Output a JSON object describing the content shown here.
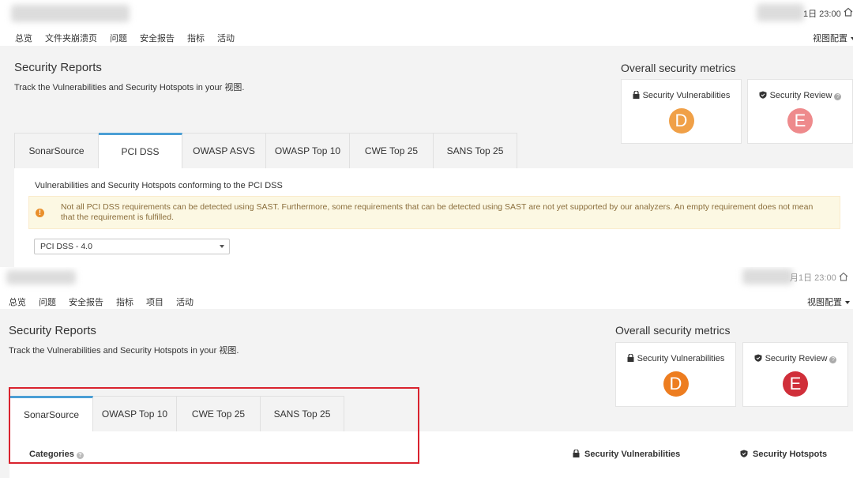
{
  "colors": {
    "grade_d_1": "#f0a047",
    "grade_e_1": "#ee8a8c",
    "grade_d_2": "#ed7d20",
    "grade_e_2": "#d02f3a",
    "active_tab_border": "#4b9fd5",
    "nav_active_border": "#236a97",
    "annotation_red": "#d9232e"
  },
  "panel1": {
    "datetime": "1日 23:00",
    "nav": [
      "总览",
      "文件夹崩溃页",
      "问题",
      "安全报告",
      "指标",
      "活动"
    ],
    "nav_active_index": 3,
    "view_config": "视图配置",
    "title": "Security Reports",
    "subtitle": "Track the Vulnerabilities and Security Hotspots in your 视图.",
    "metrics_title": "Overall security metrics",
    "metric_vuln_label": "Security Vulnerabilities",
    "metric_vuln_grade": "D",
    "metric_review_label": "Security Review",
    "metric_review_grade": "E",
    "tabs": [
      "SonarSource",
      "PCI DSS",
      "OWASP ASVS",
      "OWASP Top 10",
      "CWE Top 25",
      "SANS Top 25"
    ],
    "active_tab_index": 1,
    "description": "Vulnerabilities and Security Hotspots conforming to the PCI DSS",
    "warning": "Not all PCI DSS requirements can be detected using SAST. Furthermore, some requirements that can be detected using SAST are not yet supported by our analyzers. An empty requirement does not mean that the requirement is fulfilled.",
    "version_select": "PCI DSS - 4.0"
  },
  "panel2": {
    "datetime": "月1日 23:00",
    "nav": [
      "总览",
      "问题",
      "安全报告",
      "指标",
      "项目",
      "活动"
    ],
    "nav_active_index": 2,
    "view_config": "视图配置",
    "title": "Security Reports",
    "subtitle": "Track the Vulnerabilities and Security Hotspots in your 视图.",
    "metrics_title": "Overall security metrics",
    "metric_vuln_label": "Security Vulnerabilities",
    "metric_vuln_grade": "D",
    "metric_review_label": "Security Review",
    "metric_review_grade": "E",
    "tabs": [
      "SonarSource",
      "OWASP Top 10",
      "CWE Top 25",
      "SANS Top 25"
    ],
    "active_tab_index": 0,
    "col_categories": "Categories",
    "col_vulnerabilities": "Security Vulnerabilities",
    "col_hotspots": "Security Hotspots"
  }
}
